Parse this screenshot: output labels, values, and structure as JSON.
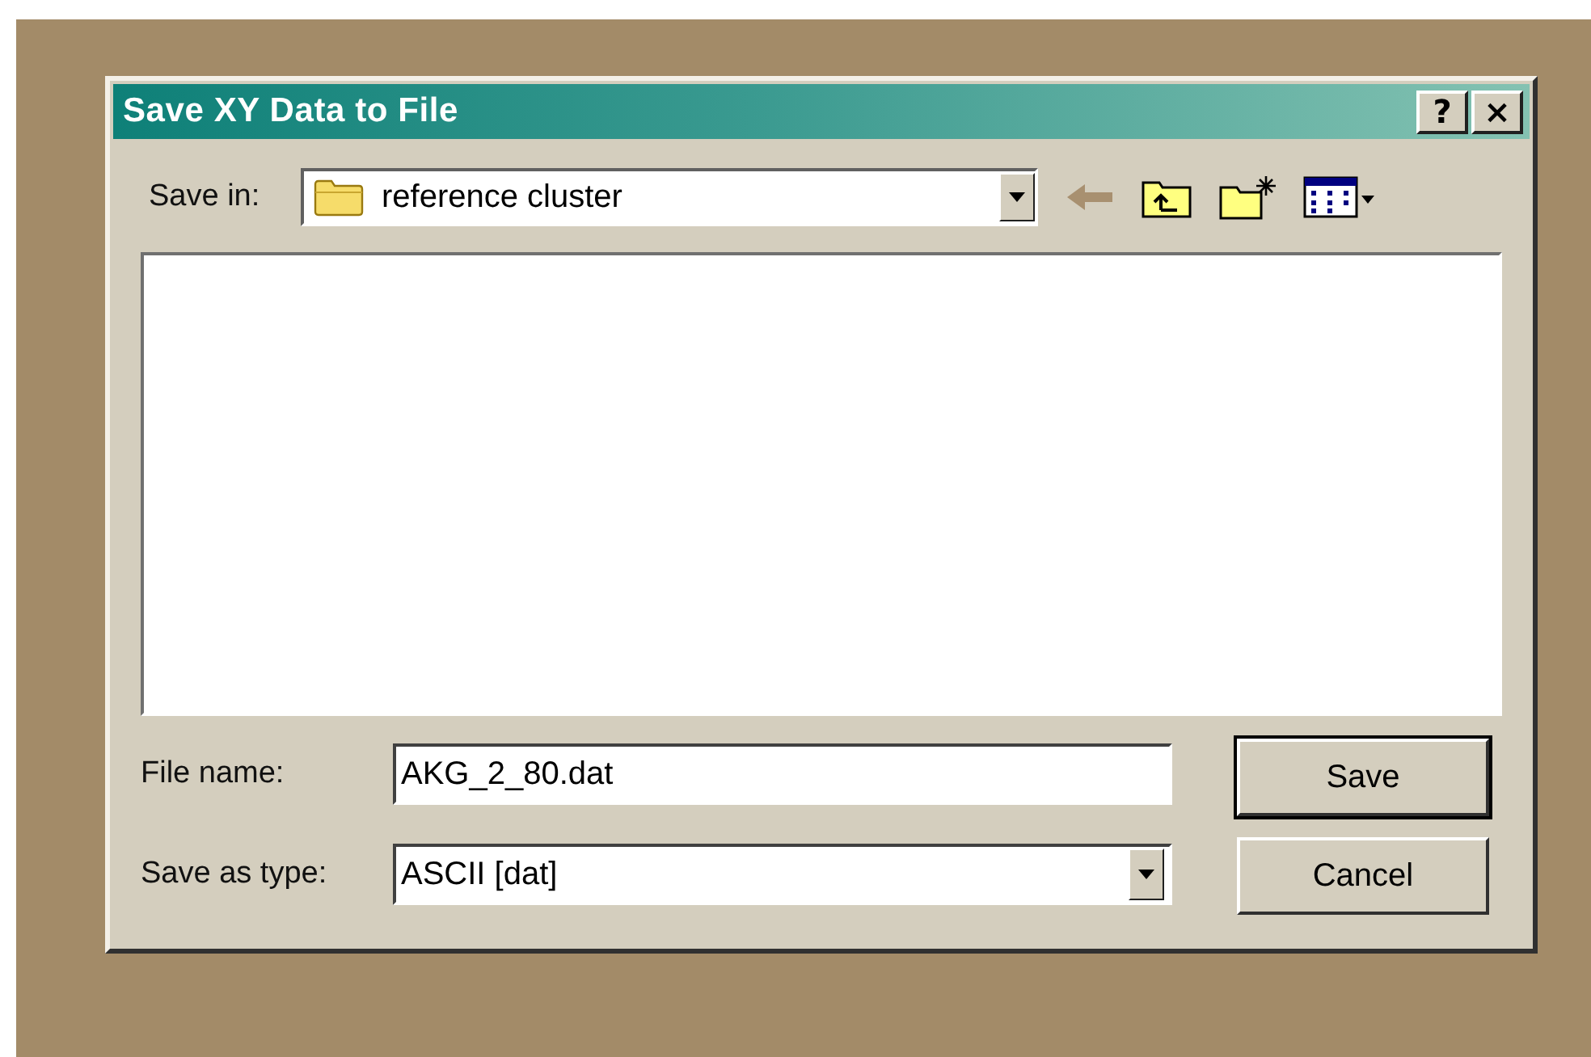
{
  "window": {
    "title": "Save XY Data to File",
    "help_button": "?",
    "close_button": "×"
  },
  "save_in": {
    "label": "Save in:",
    "value": "reference cluster"
  },
  "file_name": {
    "label": "File name:",
    "value": "AKG_2_80.dat"
  },
  "save_as_type": {
    "label": "Save as type:",
    "value": "ASCII [dat]"
  },
  "buttons": [
    {
      "label": "Save",
      "default": true
    },
    {
      "label": "Cancel",
      "default": false
    }
  ]
}
